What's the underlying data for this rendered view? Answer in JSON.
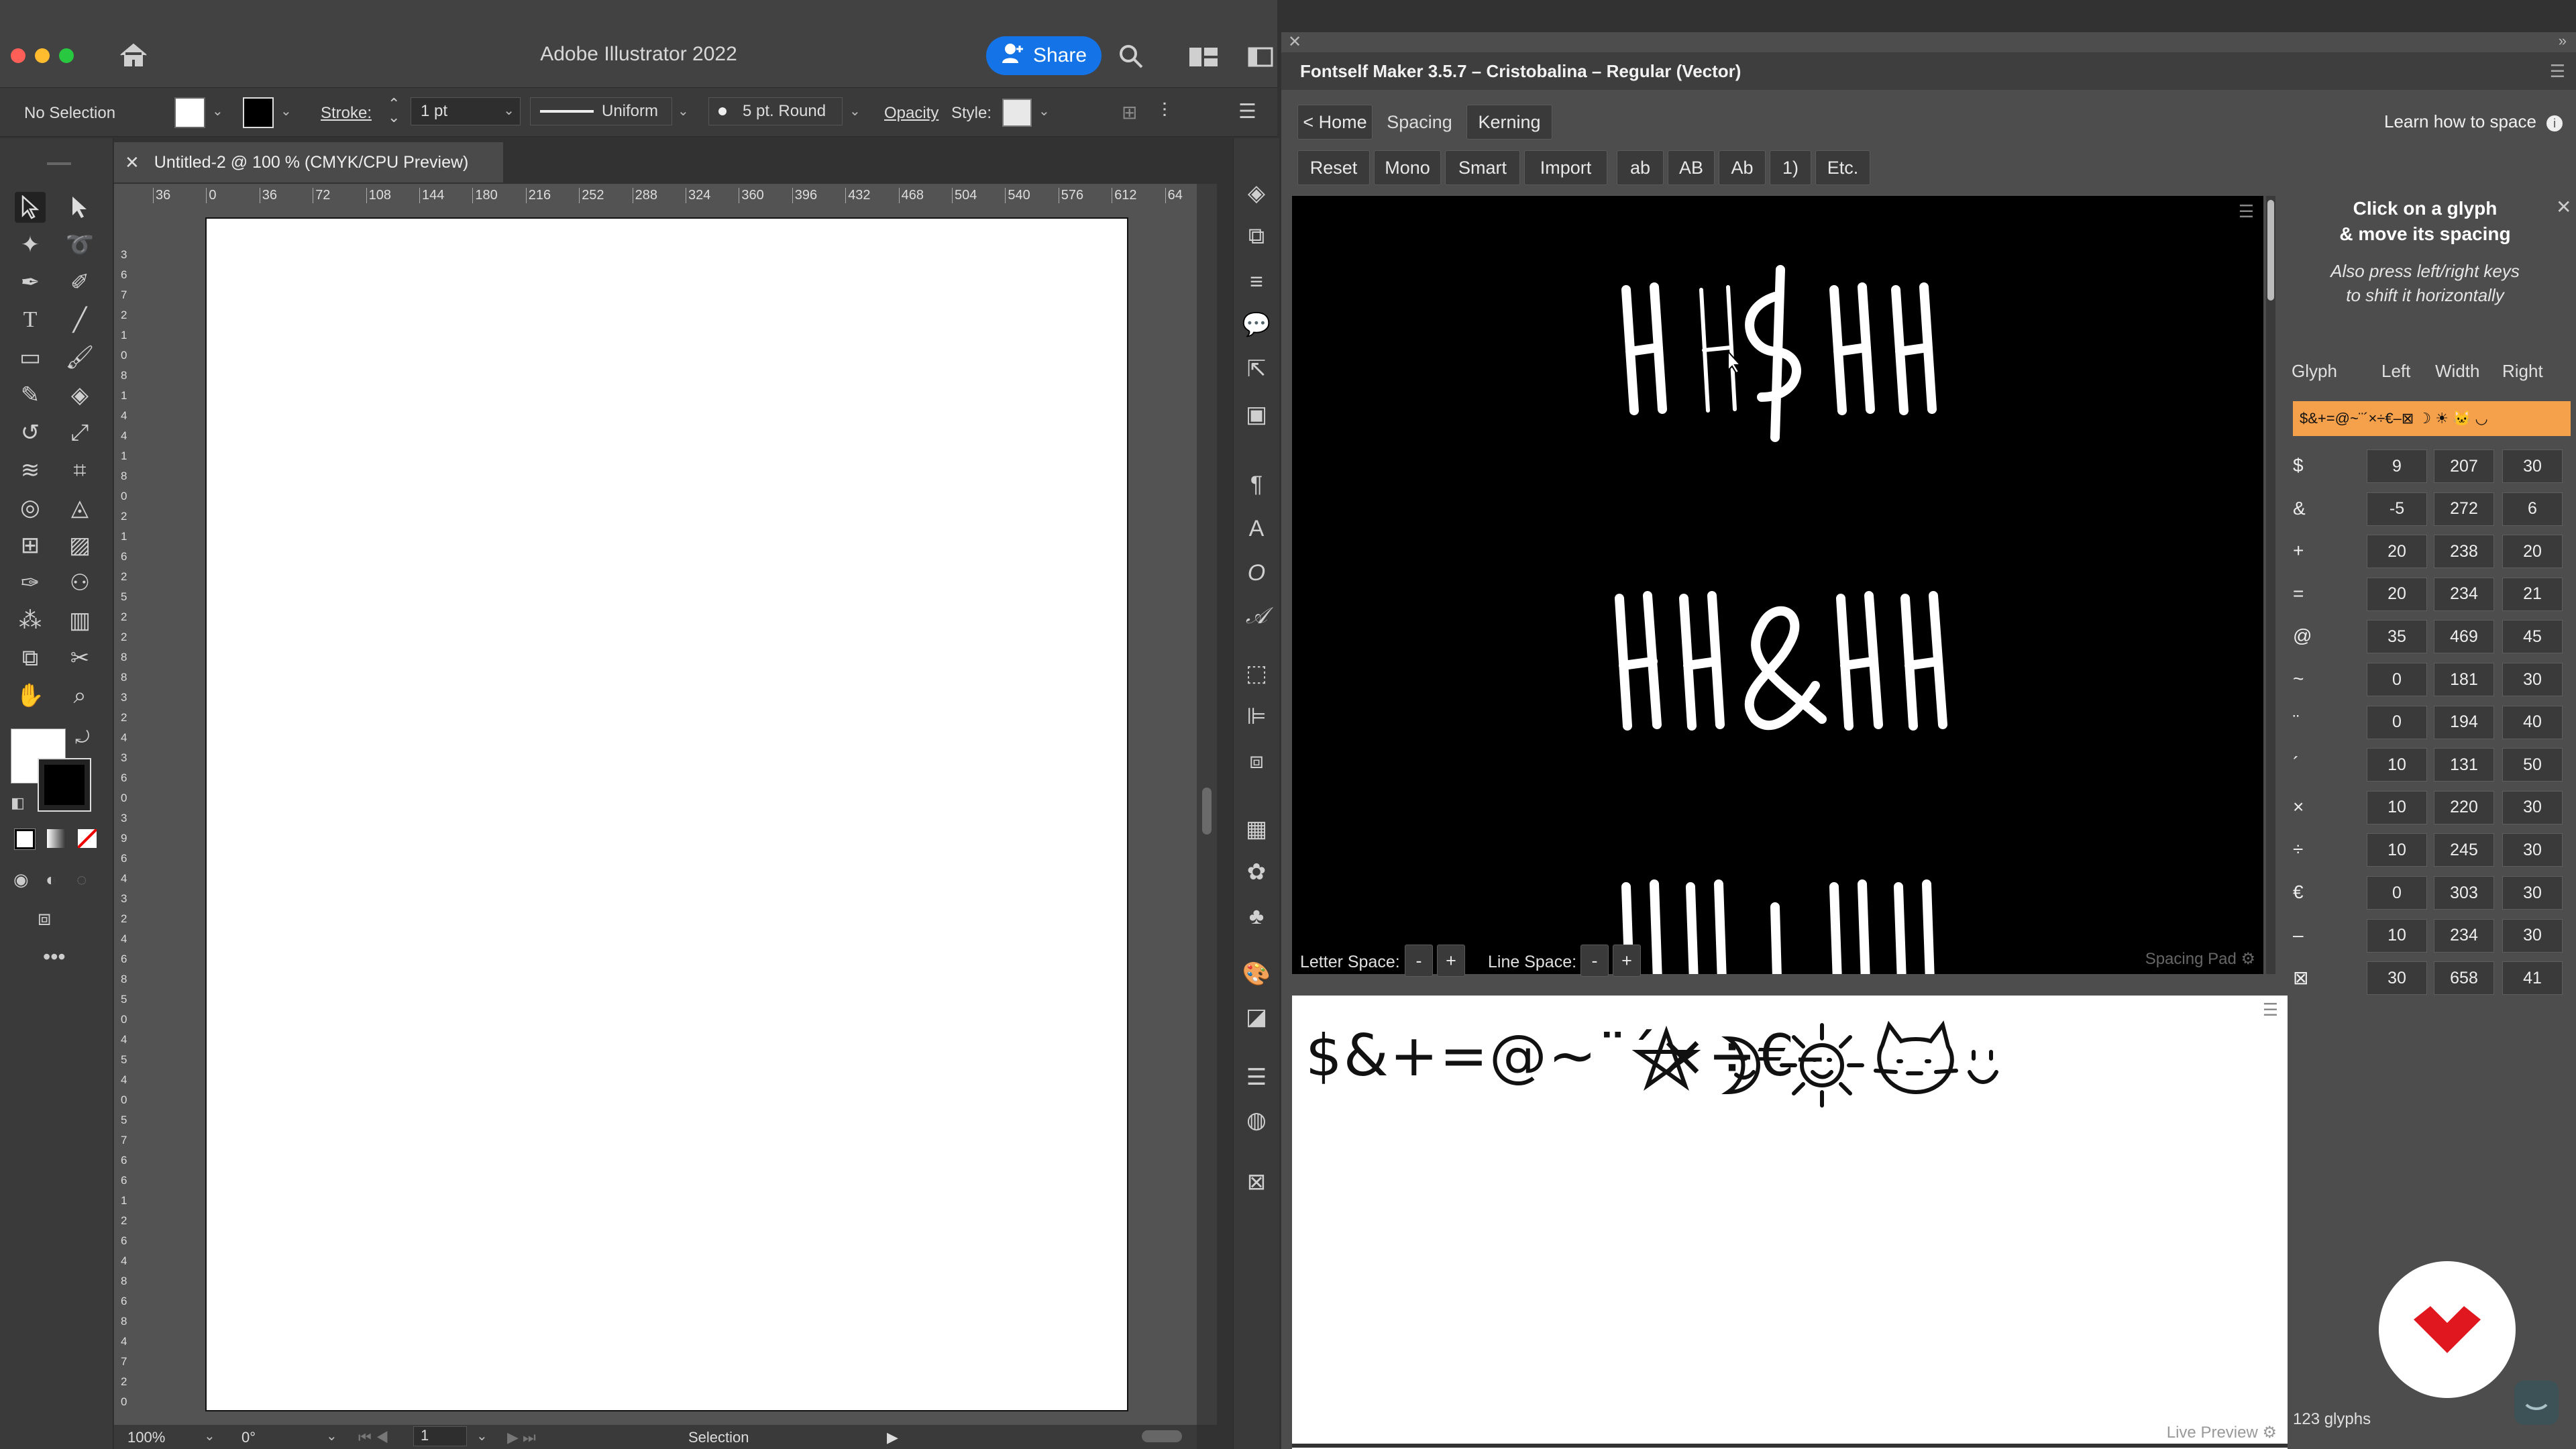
{
  "app": {
    "title": "Adobe Illustrator 2022",
    "share_label": "Share",
    "accent": "#1473e6"
  },
  "control_bar": {
    "selection": "No Selection",
    "stroke_label": "Stroke:",
    "stroke_value": "1 pt",
    "profile": "Uniform",
    "brush": "5 pt. Round",
    "opacity_label": "Opacity",
    "style_label": "Style:"
  },
  "document": {
    "tab_title": "Untitled-2 @ 100 % (CMYK/CPU Preview)",
    "ruler_top": [
      "36",
      "0",
      "36",
      "72",
      "108",
      "144",
      "180",
      "216",
      "252",
      "288",
      "324",
      "360",
      "396",
      "432",
      "468",
      "504",
      "540",
      "576",
      "612",
      "64"
    ],
    "ruler_left": [
      "3",
      "6",
      "7",
      "2",
      "1",
      "0",
      "8",
      "1",
      "4",
      "4",
      "1",
      "8",
      "0",
      "2",
      "1",
      "6",
      "2",
      "5",
      "2",
      "2",
      "8",
      "8",
      "3",
      "2",
      "4",
      "3",
      "6",
      "0",
      "3",
      "9",
      "6",
      "4",
      "3",
      "2",
      "4",
      "6",
      "8",
      "5",
      "0",
      "4",
      "5",
      "4",
      "0",
      "5",
      "7",
      "6",
      "6",
      "1",
      "2",
      "6",
      "4",
      "8",
      "6",
      "8",
      "4",
      "7",
      "2",
      "0"
    ]
  },
  "status_bar": {
    "zoom": "100%",
    "rotation": "0°",
    "artboard": "1",
    "tool": "Selection"
  },
  "fontself": {
    "title": "Fontself Maker 3.5.7 – Cristobalina – Regular (Vector)",
    "nav": {
      "home": "< Home",
      "spacing": "Spacing",
      "kerning": "Kerning"
    },
    "learn": "Learn how to space",
    "actions": [
      "Reset",
      "Mono",
      "Smart",
      "Import"
    ],
    "filters": [
      "ab",
      "AB",
      "Ab",
      "1)",
      "Etc."
    ],
    "spacing_pad_label": "Spacing Pad",
    "pad_lines": [
      "HH$HH",
      "HH&HH",
      "HH+HH"
    ],
    "letter_space_label": "Letter Space:",
    "line_space_label": "Line Space:",
    "minus": "-",
    "plus": "+",
    "live_preview_label": "Live Preview",
    "live_text": "$&+=@~¨´×÷€–",
    "help_title": "Click on a glyph\n& move its spacing",
    "help_sub": "Also press left/right keys\nto shift it horizontally",
    "table_headers": [
      "Glyph",
      "Left",
      "Width",
      "Right"
    ],
    "selected_glyphs": "$&+=@~¨´×÷€–⊠ ☽ ☀ 🐱 ◡",
    "selected_color": "#f5a04a",
    "glyphs": [
      {
        "g": "$",
        "left": "9",
        "width": "207",
        "right": "30"
      },
      {
        "g": "&",
        "left": "-5",
        "width": "272",
        "right": "6"
      },
      {
        "g": "+",
        "left": "20",
        "width": "238",
        "right": "20"
      },
      {
        "g": "=",
        "left": "20",
        "width": "234",
        "right": "21"
      },
      {
        "g": "@",
        "left": "35",
        "width": "469",
        "right": "45"
      },
      {
        "g": "~",
        "left": "0",
        "width": "181",
        "right": "30"
      },
      {
        "g": "¨",
        "left": "0",
        "width": "194",
        "right": "40"
      },
      {
        "g": "´",
        "left": "10",
        "width": "131",
        "right": "50"
      },
      {
        "g": "×",
        "left": "10",
        "width": "220",
        "right": "30"
      },
      {
        "g": "÷",
        "left": "10",
        "width": "245",
        "right": "30"
      },
      {
        "g": "€",
        "left": "0",
        "width": "303",
        "right": "30"
      },
      {
        "g": "–",
        "left": "10",
        "width": "234",
        "right": "30"
      },
      {
        "g": "⊠",
        "left": "30",
        "width": "658",
        "right": "41"
      }
    ],
    "glyph_count": "123 glyphs",
    "brand_color": "#e0171e"
  }
}
